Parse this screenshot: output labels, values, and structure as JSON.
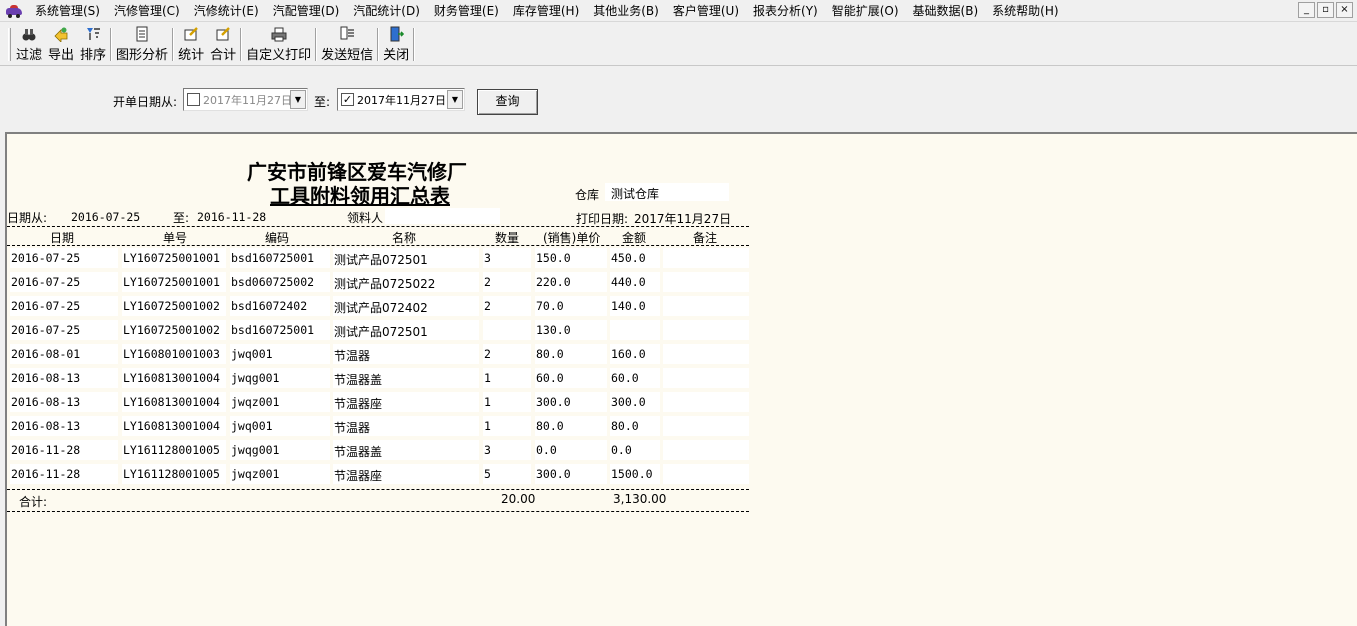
{
  "menubar": {
    "items": [
      "系统管理(S)",
      "汽修管理(C)",
      "汽修统计(E)",
      "汽配管理(D)",
      "汽配统计(D)",
      "财务管理(E)",
      "库存管理(H)",
      "其他业务(B)",
      "客户管理(U)",
      "报表分析(Y)",
      "智能扩展(O)",
      "基础数据(B)",
      "系统帮助(H)"
    ],
    "window_controls": [
      "_",
      "▫",
      "×"
    ]
  },
  "toolbar": {
    "filter": "过滤",
    "export": "导出",
    "sort": "排序",
    "chart": "图形分析",
    "stats": "统计",
    "total": "合计",
    "custom_print": "自定义打印",
    "sms": "发送短信",
    "close": "关闭"
  },
  "filter": {
    "date_from_label": "开单日期从:",
    "date_from_value": "2017年11月27日",
    "date_from_checked": "",
    "to_label": "至:",
    "date_to_value": "2017年11月27日",
    "date_to_checked": "✓",
    "query_button": "查询"
  },
  "report": {
    "company": "广安市前锋区爱车汽修厂",
    "title": "工具附料领用汇总表",
    "warehouse_label": "仓库",
    "warehouse_value": "测试仓库",
    "date_from_label": "日期从:",
    "date_from": "2016-07-25",
    "date_to_label": "至:",
    "date_to": "2016-11-28",
    "receiver_label": "领料人",
    "receiver_value": "",
    "print_date_label": "打印日期:",
    "print_date": "2017年11月27日",
    "columns": [
      "日期",
      "单号",
      "编码",
      "名称",
      "数量",
      "(销售)单价",
      "金额",
      "备注"
    ],
    "rows": [
      [
        "2016-07-25",
        "LY160725001001",
        "bsd160725001",
        "测试产品072501",
        "3",
        "150.0",
        "450.0",
        ""
      ],
      [
        "2016-07-25",
        "LY160725001001",
        "bsd060725002",
        "测试产品0725022",
        "2",
        "220.0",
        "440.0",
        ""
      ],
      [
        "2016-07-25",
        "LY160725001002",
        "bsd16072402",
        "测试产品072402",
        "2",
        "70.0",
        "140.0",
        ""
      ],
      [
        "2016-07-25",
        "LY160725001002",
        "bsd160725001",
        "测试产品072501",
        "",
        "130.0",
        "",
        ""
      ],
      [
        "2016-08-01",
        "LY160801001003",
        "jwq001",
        "节温器",
        "2",
        "80.0",
        "160.0",
        ""
      ],
      [
        "2016-08-13",
        "LY160813001004",
        "jwqg001",
        "节温器盖",
        "1",
        "60.0",
        "60.0",
        ""
      ],
      [
        "2016-08-13",
        "LY160813001004",
        "jwqz001",
        "节温器座",
        "1",
        "300.0",
        "300.0",
        ""
      ],
      [
        "2016-08-13",
        "LY160813001004",
        "jwq001",
        "节温器",
        "1",
        "80.0",
        "80.0",
        ""
      ],
      [
        "2016-11-28",
        "LY161128001005",
        "jwqg001",
        "节温器盖",
        "3",
        "0.0",
        "0.0",
        ""
      ],
      [
        "2016-11-28",
        "LY161128001005",
        "jwqz001",
        "节温器座",
        "5",
        "300.0",
        "1500.0",
        ""
      ]
    ],
    "total_label": "合计:",
    "total_qty": "20.00",
    "total_amount": "3,130.00"
  }
}
